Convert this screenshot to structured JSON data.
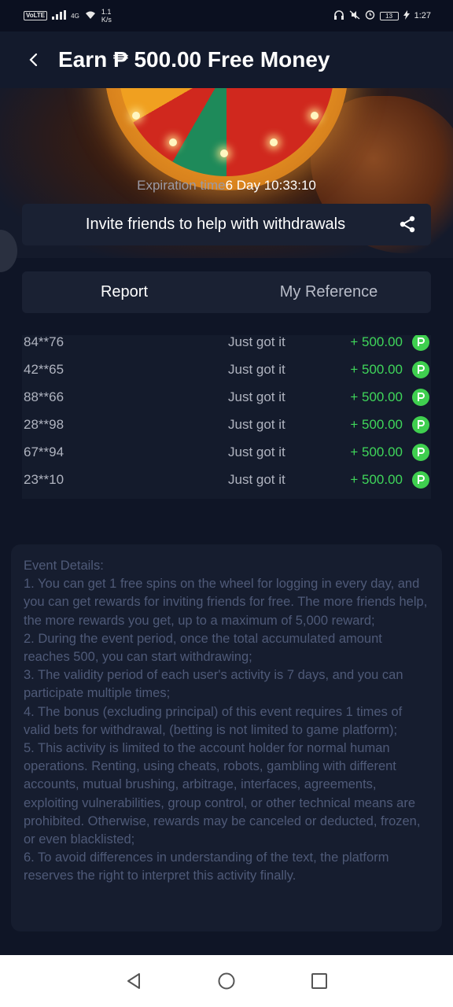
{
  "status_bar": {
    "left_badge": "VoLTE",
    "network": "4G",
    "speed_value": "1.1",
    "speed_unit": "K/s",
    "battery": "13",
    "time": "1:27"
  },
  "header": {
    "title": "Earn ₱ 500.00 Free Money"
  },
  "hero": {
    "expiration_label": "Expiration time",
    "expiration_value": "6 Day 10:33:10"
  },
  "invite": {
    "label": "Invite friends to help with withdrawals"
  },
  "tabs": [
    {
      "label": "Report",
      "active": true
    },
    {
      "label": "My Reference",
      "active": false
    }
  ],
  "winners": [
    {
      "user": "84**76",
      "status": "Just got it",
      "amount": "+ 500.00"
    },
    {
      "user": "42**65",
      "status": "Just got it",
      "amount": "+ 500.00"
    },
    {
      "user": "88**66",
      "status": "Just got it",
      "amount": "+ 500.00"
    },
    {
      "user": "28**98",
      "status": "Just got it",
      "amount": "+ 500.00"
    },
    {
      "user": "67**94",
      "status": "Just got it",
      "amount": "+ 500.00"
    },
    {
      "user": "23**10",
      "status": "Just got it",
      "amount": "+ 500.00"
    }
  ],
  "details": {
    "heading": "Event Details:",
    "items": [
      "1. You can get 1 free spins on the wheel for logging in every day, and you can get rewards for inviting friends for free. The more friends help, the more rewards you get, up to a maximum of 5,000 reward;",
      "2. During the event period, once the total accumulated amount reaches 500, you can start withdrawing;",
      "3. The validity period of each user's activity is 7 days, and you can participate multiple times;",
      "4. The bonus (excluding principal) of this event requires 1 times of valid bets for withdrawal, (betting is not limited to game platform);",
      "5. This activity is limited to the account holder for normal human operations. Renting, using cheats, robots, gambling with different accounts, mutual brushing, arbitrage, interfaces, agreements, exploiting vulnerabilities, group control, or other technical means are prohibited. Otherwise, rewards may be canceled or deducted, frozen, or even blacklisted;",
      "6. To avoid differences in understanding of the text, the platform reserves the right to interpret this activity finally."
    ]
  },
  "colors": {
    "background": "#0f1526",
    "card": "#1a2133",
    "amount_green": "#3fd65a",
    "details_text": "#4f5a78"
  }
}
